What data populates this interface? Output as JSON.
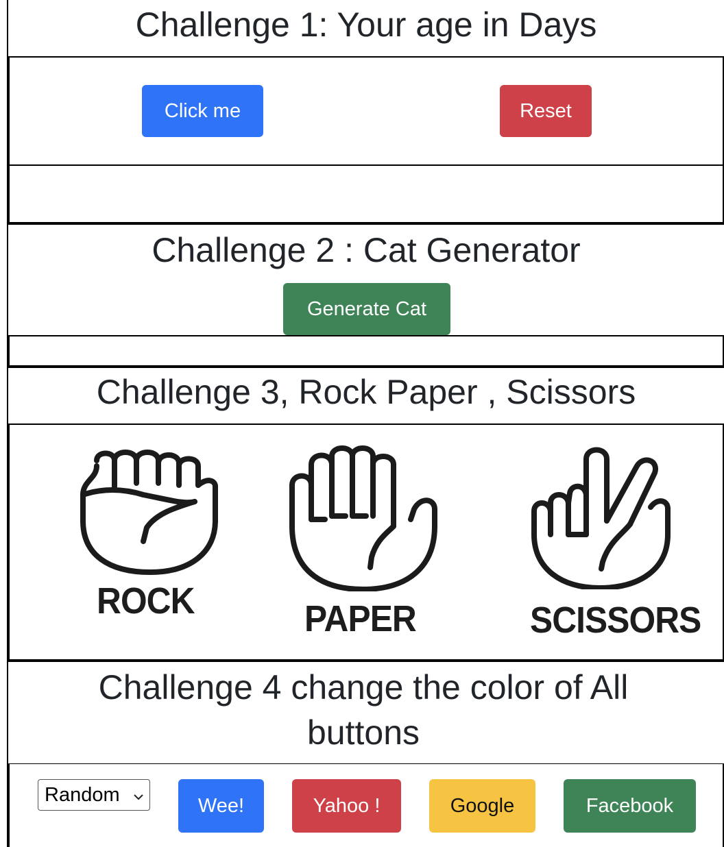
{
  "challenge1": {
    "title": "Challenge 1: Your age in Days",
    "click_label": "Click me",
    "reset_label": "Reset"
  },
  "challenge2": {
    "title": "Challenge 2 : Cat Generator",
    "generate_label": "Generate Cat"
  },
  "challenge3": {
    "title": "Challenge 3, Rock Paper , Scissors",
    "choices": [
      {
        "label": "ROCK",
        "icon": "fist-icon"
      },
      {
        "label": "PAPER",
        "icon": "open-hand-icon"
      },
      {
        "label": "SCISSORS",
        "icon": "peace-hand-icon"
      }
    ]
  },
  "challenge4": {
    "title": "Challenge 4 change the color of All buttons",
    "select_value": "Random",
    "buttons": [
      "Wee!",
      "Yahoo !",
      "Google",
      "Facebook"
    ]
  },
  "colors": {
    "primary": "#2f74f6",
    "danger": "#ce4148",
    "success": "#3e8457",
    "warning": "#f6c343"
  }
}
